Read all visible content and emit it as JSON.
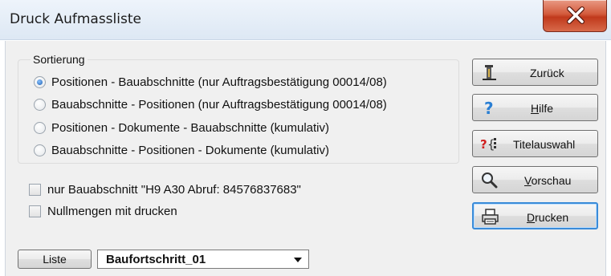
{
  "window": {
    "title": "Druck Aufmassliste"
  },
  "sort_group": {
    "legend": "Sortierung",
    "options": [
      {
        "label": "Positionen - Bauabschnitte (nur Auftragsbestätigung 00014/08)",
        "selected": true
      },
      {
        "label": "Bauabschnitte - Positionen (nur Auftragsbestätigung 00014/08)",
        "selected": false
      },
      {
        "label": "Positionen - Dokumente - Bauabschnitte (kumulativ)",
        "selected": false
      },
      {
        "label": "Bauabschnitte - Positionen - Dokumente (kumulativ)",
        "selected": false
      }
    ]
  },
  "checkboxes": [
    {
      "label": "nur Bauabschnitt \"H9 A30   Abruf: 84576837683\"",
      "checked": false
    },
    {
      "label": "Nullmengen mit drucken",
      "checked": false
    }
  ],
  "buttons": {
    "back": {
      "label": "Zurück",
      "icon": "door-exit-icon"
    },
    "help": {
      "label_pre": "",
      "label_ul": "H",
      "label_post": "ilfe",
      "icon": "question-icon"
    },
    "title_select": {
      "label": "Titelauswahl",
      "icon": "title-select-icon"
    },
    "preview": {
      "label_ul": "V",
      "label_post": "orschau",
      "icon": "magnifier-icon"
    },
    "print": {
      "label_ul": "D",
      "label_post": "rucken",
      "icon": "printer-icon"
    }
  },
  "footer": {
    "liste_label": "Liste",
    "select_value": "Baufortschritt_01"
  },
  "colors": {
    "close_button": "#c9452a",
    "default_button_border": "#3a8bd8",
    "dialog_background": "#f0f0f0"
  }
}
